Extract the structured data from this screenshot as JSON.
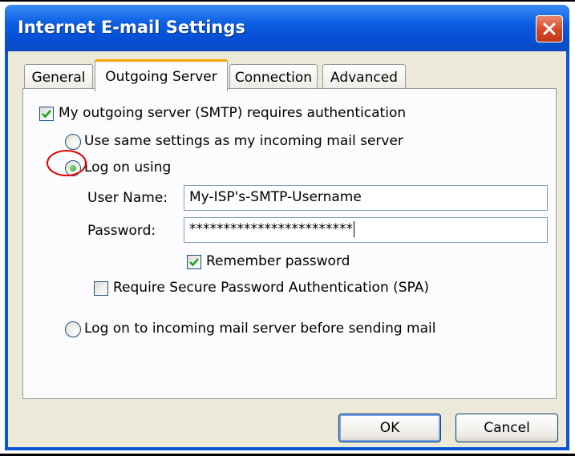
{
  "window": {
    "title": "Internet E-mail Settings"
  },
  "tabs": [
    {
      "label": "General"
    },
    {
      "label": "Outgoing Server"
    },
    {
      "label": "Connection"
    },
    {
      "label": "Advanced"
    }
  ],
  "outgoing": {
    "requires_auth": {
      "label": "My outgoing server (SMTP) requires authentication",
      "checked": true
    },
    "option_same": {
      "label": "Use same settings as my incoming mail server",
      "selected": false
    },
    "option_logon": {
      "label": "Log on using",
      "selected": true
    },
    "username": {
      "label": "User Name:",
      "value": "My-ISP's-SMTP-Username"
    },
    "password": {
      "label": "Password:",
      "value": "************************"
    },
    "remember": {
      "label": "Remember password",
      "checked": true
    },
    "spa": {
      "label": "Require Secure Password Authentication (SPA)",
      "checked": false
    },
    "option_incoming_first": {
      "label": "Log on to incoming mail server before sending mail",
      "selected": false
    }
  },
  "buttons": {
    "ok": "OK",
    "cancel": "Cancel"
  },
  "icons": {
    "close": "close-icon",
    "checkmark": "checkmark-icon"
  },
  "colors": {
    "titlebar": "#0550d6",
    "close": "#d64824",
    "highlight_ring": "#e00000",
    "active_tab_accent": "#f5a700"
  }
}
